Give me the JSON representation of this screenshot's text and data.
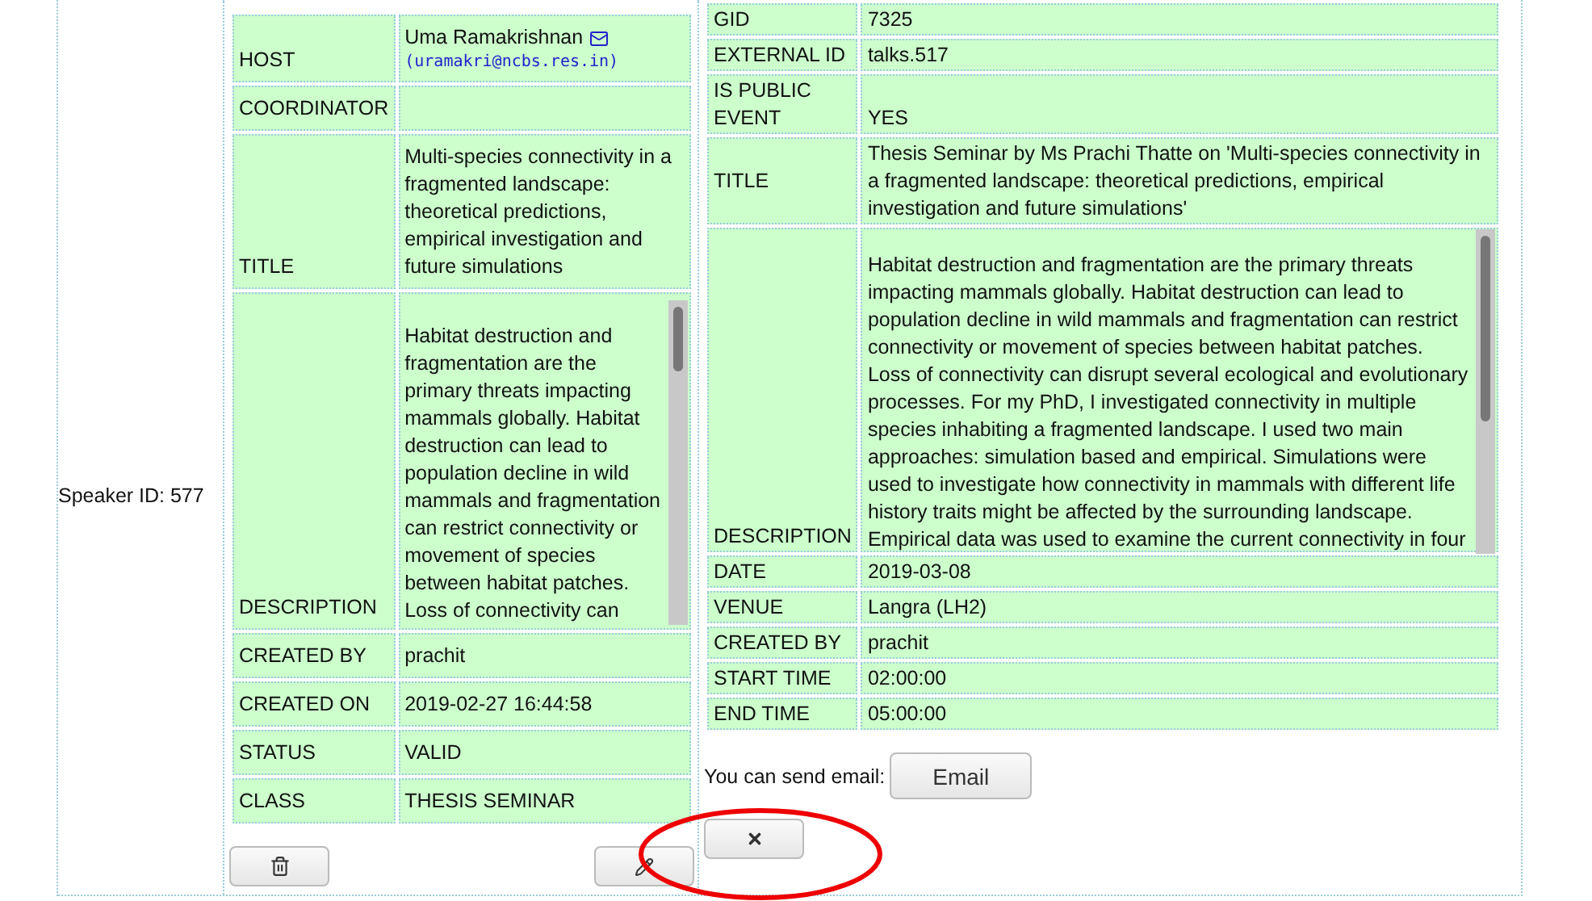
{
  "speaker_id": "Speaker ID: 577",
  "left_table": {
    "rows": [
      {
        "kind": "host",
        "label": "HOST",
        "value": "Uma Ramakrishnan",
        "email": "(uramakri@ncbs.res.in)"
      },
      {
        "kind": "text",
        "label": "COORDINATOR"
      },
      {
        "kind": "text",
        "label": "TITLE",
        "value": "Multi-species connectivity in a fragmented landscape: theoretical predictions, empirical investigation and future simulations"
      },
      {
        "kind": "scroll",
        "label": "DESCRIPTION",
        "value": "Habitat destruction and fragmentation are the primary threats impacting mammals globally. Habitat destruction can lead to population decline in wild mammals and fragmentation can restrict connectivity or movement of species between habitat patches. Loss of connectivity can"
      },
      {
        "kind": "text",
        "label": "CREATED BY",
        "value": "prachit"
      },
      {
        "kind": "text",
        "label": "CREATED ON",
        "value": "2019-02-27 16:44:58"
      },
      {
        "kind": "text",
        "label": "STATUS",
        "value": "VALID"
      },
      {
        "kind": "text",
        "label": "CLASS",
        "value": "THESIS SEMINAR"
      }
    ]
  },
  "right_table": {
    "rows": [
      {
        "kind": "text",
        "label": "GID",
        "value": "7325"
      },
      {
        "kind": "text",
        "label": "EXTERNAL ID",
        "value": "talks.517"
      },
      {
        "kind": "text",
        "label": "IS PUBLIC EVENT",
        "value": "YES"
      },
      {
        "kind": "text",
        "label": "TITLE",
        "value": "Thesis Seminar by Ms Prachi Thatte on 'Multi-species connectivity in a fragmented landscape: theoretical predictions, empirical investigation and future simulations'"
      },
      {
        "kind": "scroll",
        "label": "DESCRIPTION",
        "value": "Habitat destruction and fragmentation are the primary threats impacting mammals globally. Habitat destruction can lead to population decline in wild mammals and fragmentation can restrict connectivity or movement of species between habitat patches. Loss of connectivity can disrupt several ecological and evolutionary processes. For my PhD, I investigated connectivity in multiple species inhabiting a fragmented landscape. I used two main approaches: simulation based and empirical. Simulations were used to investigate how connectivity in mammals with different life history traits might be affected by the surrounding landscape. Empirical data was used to examine the current connectivity in four"
      },
      {
        "kind": "text",
        "label": "DATE",
        "value": "2019-03-08"
      },
      {
        "kind": "text",
        "label": "VENUE",
        "value": "Langra (LH2)"
      },
      {
        "kind": "text",
        "label": "CREATED BY",
        "value": "prachit"
      },
      {
        "kind": "text",
        "label": "START TIME",
        "value": "02:00:00"
      },
      {
        "kind": "text",
        "label": "END TIME",
        "value": "05:00:00"
      }
    ]
  },
  "email_prompt": "You can send email:",
  "email_button": "Email"
}
